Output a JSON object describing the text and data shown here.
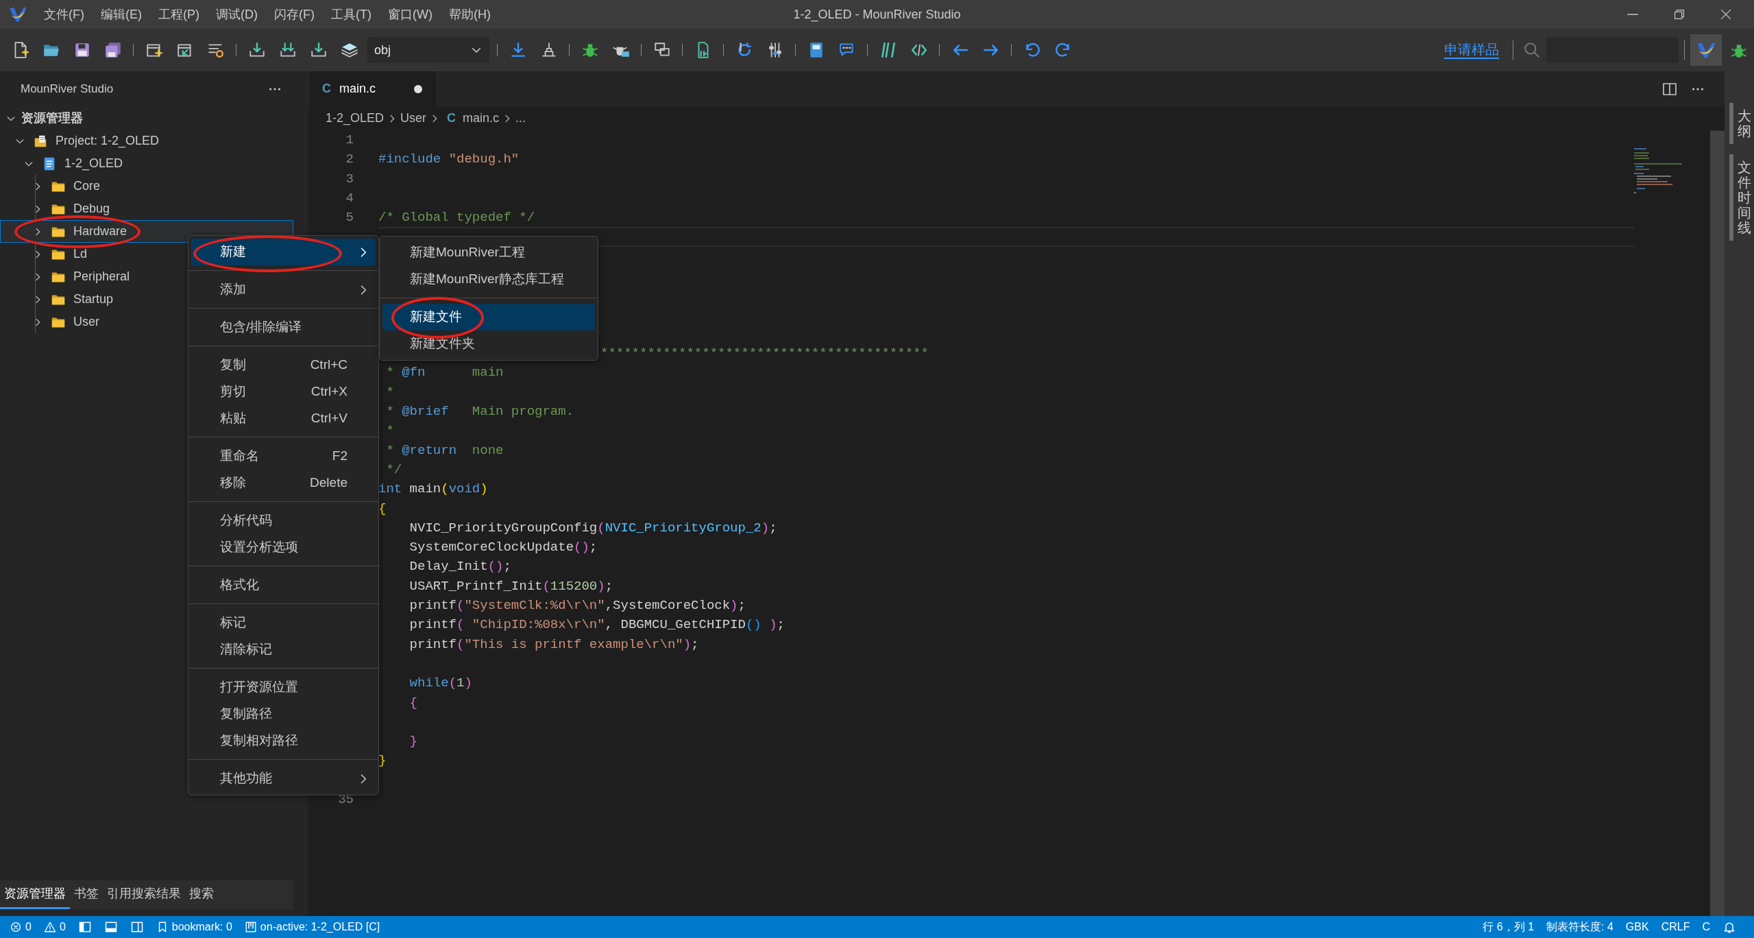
{
  "window": {
    "title": "1-2_OLED - MounRiver Studio"
  },
  "menu_bar": [
    "文件(F)",
    "编辑(E)",
    "工程(P)",
    "调试(D)",
    "闪存(F)",
    "工具(T)",
    "窗口(W)",
    "帮助(H)"
  ],
  "toolbar": {
    "config": "obj",
    "sample_link": "申请样品"
  },
  "explorer": {
    "title": "MounRiver Studio",
    "tree": [
      {
        "kind": "section",
        "label": "资源管理器",
        "expanded": true,
        "selected": false,
        "circled": false,
        "children": [
          {
            "kind": "project",
            "label": "Project: 1-2_OLED",
            "expanded": true,
            "selected": false,
            "circled": false,
            "children": [
              {
                "kind": "target",
                "label": "1-2_OLED",
                "expanded": true,
                "selected": false,
                "circled": false,
                "children": [
                  {
                    "kind": "folder",
                    "label": "Core",
                    "expanded": false,
                    "selected": false,
                    "circled": false
                  },
                  {
                    "kind": "folder",
                    "label": "Debug",
                    "expanded": false,
                    "selected": false,
                    "circled": false
                  },
                  {
                    "kind": "folder",
                    "label": "Hardware",
                    "expanded": false,
                    "selected": true,
                    "circled": true
                  },
                  {
                    "kind": "folder",
                    "label": "Ld",
                    "expanded": false,
                    "selected": false,
                    "circled": false
                  },
                  {
                    "kind": "folder",
                    "label": "Peripheral",
                    "expanded": false,
                    "selected": false,
                    "circled": false
                  },
                  {
                    "kind": "folder",
                    "label": "Startup",
                    "expanded": false,
                    "selected": false,
                    "circled": false
                  },
                  {
                    "kind": "folder",
                    "label": "User",
                    "expanded": false,
                    "selected": false,
                    "circled": false
                  }
                ]
              }
            ]
          }
        ]
      }
    ]
  },
  "bottom_tabs": [
    {
      "label": "资源管理器",
      "selected": true
    },
    {
      "label": "书签",
      "selected": false
    },
    {
      "label": "引用搜索结果",
      "selected": false
    },
    {
      "label": "搜索",
      "selected": false
    }
  ],
  "editor": {
    "tabs": [
      {
        "icon_text": "C",
        "label": "main.c",
        "selected": true,
        "modified": true
      }
    ],
    "breadcrumb": [
      {
        "label": "1-2_OLED"
      },
      {
        "label": "User"
      },
      {
        "icon_text": "C",
        "label": "main.c"
      },
      {
        "label": "..."
      }
    ],
    "lines": [
      {
        "number": "1",
        "current": false
      },
      {
        "number": "2",
        "current": false,
        "tokens": [
          {
            "text": "#include ",
            "kind": "keyword"
          },
          {
            "text": "\"debug.h\"",
            "kind": "string"
          }
        ]
      },
      {
        "number": "3",
        "current": false
      },
      {
        "number": "4",
        "current": false
      },
      {
        "number": "5",
        "current": false,
        "tokens": [
          {
            "text": "/* Global typedef */",
            "kind": "comment"
          }
        ]
      },
      {
        "current": true
      },
      {
        "current": false
      },
      {
        "current": false
      },
      {
        "current": false
      },
      {
        "current": false
      },
      {
        "current": false
      },
      {
        "current": false,
        "kind": "partial",
        "tokens": [
          {
            "text": "******************************************",
            "kind": "comment"
          }
        ]
      },
      {
        "current": false,
        "tokens": [
          {
            "text": " * ",
            "kind": "comment"
          },
          {
            "text": "@fn",
            "kind": "tag"
          },
          {
            "text": "      main",
            "kind": "comment"
          }
        ]
      },
      {
        "current": false,
        "tokens": [
          {
            "text": " *",
            "kind": "comment"
          }
        ]
      },
      {
        "current": false,
        "tokens": [
          {
            "text": " * ",
            "kind": "comment"
          },
          {
            "text": "@brief",
            "kind": "tag"
          },
          {
            "text": "   Main program.",
            "kind": "comment"
          }
        ]
      },
      {
        "current": false,
        "tokens": [
          {
            "text": " *",
            "kind": "comment"
          }
        ]
      },
      {
        "current": false,
        "tokens": [
          {
            "text": " * ",
            "kind": "comment"
          },
          {
            "text": "@return",
            "kind": "tag"
          },
          {
            "text": "  none",
            "kind": "comment"
          }
        ]
      },
      {
        "current": false,
        "tokens": [
          {
            "text": " */",
            "kind": "comment"
          }
        ]
      },
      {
        "current": false,
        "tokens": [
          {
            "text": "int",
            "kind": "keyword"
          },
          {
            "text": " main",
            "kind": "plain"
          },
          {
            "text": "(",
            "kind": "bracket1"
          },
          {
            "text": "void",
            "kind": "keyword"
          },
          {
            "text": ")",
            "kind": "bracket1"
          }
        ]
      },
      {
        "current": false,
        "tokens": [
          {
            "text": "{",
            "kind": "bracket1"
          }
        ]
      },
      {
        "current": false,
        "tokens": [
          {
            "text": "    NVIC_PriorityGroupConfig",
            "kind": "plain"
          },
          {
            "text": "(",
            "kind": "bracket2"
          },
          {
            "text": "NVIC_PriorityGroup_2",
            "kind": "macro"
          },
          {
            "text": ")",
            "kind": "bracket2"
          },
          {
            "text": ";",
            "kind": "plain"
          }
        ]
      },
      {
        "current": false,
        "tokens": [
          {
            "text": "    SystemCoreClockUpdate",
            "kind": "plain"
          },
          {
            "text": "()",
            "kind": "bracket2"
          },
          {
            "text": ";",
            "kind": "plain"
          }
        ]
      },
      {
        "current": false,
        "tokens": [
          {
            "text": "    Delay_Init",
            "kind": "plain"
          },
          {
            "text": "()",
            "kind": "bracket2"
          },
          {
            "text": ";",
            "kind": "plain"
          }
        ]
      },
      {
        "current": false,
        "tokens": [
          {
            "text": "    USART_Printf_Init",
            "kind": "plain"
          },
          {
            "text": "(",
            "kind": "bracket2"
          },
          {
            "text": "115200",
            "kind": "number"
          },
          {
            "text": ")",
            "kind": "bracket2"
          },
          {
            "text": ";",
            "kind": "plain"
          }
        ]
      },
      {
        "current": false,
        "tokens": [
          {
            "text": "    printf",
            "kind": "plain"
          },
          {
            "text": "(",
            "kind": "bracket2"
          },
          {
            "text": "\"SystemClk:%d\\r\\n\"",
            "kind": "string"
          },
          {
            "text": ",SystemCoreClock",
            "kind": "plain"
          },
          {
            "text": ")",
            "kind": "bracket2"
          },
          {
            "text": ";",
            "kind": "plain"
          }
        ]
      },
      {
        "current": false,
        "tokens": [
          {
            "text": "    printf",
            "kind": "plain"
          },
          {
            "text": "( ",
            "kind": "bracket2"
          },
          {
            "text": "\"ChipID:%08x\\r\\n\"",
            "kind": "string"
          },
          {
            "text": ", DBGMCU_GetCHIPID",
            "kind": "plain"
          },
          {
            "text": "() ",
            "kind": "bracket3"
          },
          {
            "text": ")",
            "kind": "bracket2"
          },
          {
            "text": ";",
            "kind": "plain"
          }
        ]
      },
      {
        "current": false,
        "tokens": [
          {
            "text": "    printf",
            "kind": "plain"
          },
          {
            "text": "(",
            "kind": "bracket2"
          },
          {
            "text": "\"This is printf example\\r\\n\"",
            "kind": "string"
          },
          {
            "text": ")",
            "kind": "bracket2"
          },
          {
            "text": ";",
            "kind": "plain"
          }
        ]
      },
      {
        "current": false
      },
      {
        "current": false,
        "tokens": [
          {
            "text": "    while",
            "kind": "keyword"
          },
          {
            "text": "(",
            "kind": "bracket2"
          },
          {
            "text": "1",
            "kind": "number"
          },
          {
            "text": ")",
            "kind": "bracket2"
          }
        ]
      },
      {
        "current": false,
        "tokens": [
          {
            "text": "    {",
            "kind": "bracket2"
          }
        ]
      },
      {
        "current": false
      },
      {
        "current": false,
        "tokens": [
          {
            "text": "    }",
            "kind": "bracket2"
          }
        ]
      },
      {
        "current": false,
        "tokens": [
          {
            "text": "}",
            "kind": "bracket1"
          }
        ]
      },
      {
        "current": false
      },
      {
        "number": "35",
        "current": false
      }
    ]
  },
  "right_panel_tabs": [
    {
      "label": "大纲"
    },
    {
      "label": "文件时间线"
    }
  ],
  "context_menu": {
    "groups": [
      [
        {
          "label": "新建",
          "has_submenu": true,
          "selected": true,
          "circled": true
        }
      ],
      [
        {
          "label": "添加",
          "has_submenu": true,
          "selected": false,
          "circled": false
        }
      ],
      [
        {
          "label": "包含/排除编译",
          "has_submenu": false,
          "selected": false,
          "circled": false
        }
      ],
      [
        {
          "label": "复制",
          "shortcut": "Ctrl+C",
          "has_submenu": false,
          "selected": false,
          "circled": false
        },
        {
          "label": "剪切",
          "shortcut": "Ctrl+X",
          "has_submenu": false,
          "selected": false,
          "circled": false
        },
        {
          "label": "粘贴",
          "shortcut": "Ctrl+V",
          "has_submenu": false,
          "selected": false,
          "circled": false
        }
      ],
      [
        {
          "label": "重命名",
          "shortcut": "F2",
          "has_submenu": false,
          "selected": false,
          "circled": false
        },
        {
          "label": "移除",
          "shortcut": "Delete",
          "has_submenu": false,
          "selected": false,
          "circled": false
        }
      ],
      [
        {
          "label": "分析代码",
          "has_submenu": false,
          "selected": false,
          "circled": false
        },
        {
          "label": "设置分析选项",
          "has_submenu": false,
          "selected": false,
          "circled": false
        }
      ],
      [
        {
          "label": "格式化",
          "has_submenu": false,
          "selected": false,
          "circled": false
        }
      ],
      [
        {
          "label": "标记",
          "has_submenu": false,
          "selected": false,
          "circled": false
        },
        {
          "label": "清除标记",
          "has_submenu": false,
          "selected": false,
          "circled": false
        }
      ],
      [
        {
          "label": "打开资源位置",
          "has_submenu": false,
          "selected": false,
          "circled": false
        },
        {
          "label": "复制路径",
          "has_submenu": false,
          "selected": false,
          "circled": false
        },
        {
          "label": "复制相对路径",
          "has_submenu": false,
          "selected": false,
          "circled": false
        }
      ],
      [
        {
          "label": "其他功能",
          "has_submenu": true,
          "selected": false,
          "circled": false
        }
      ]
    ]
  },
  "submenu": {
    "groups": [
      [
        {
          "label": "新建MounRiver工程",
          "selected": false,
          "circled": false
        },
        {
          "label": "新建MounRiver静态库工程",
          "selected": false,
          "circled": false
        }
      ],
      [
        {
          "label": "新建文件",
          "selected": true,
          "circled": true
        },
        {
          "label": "新建文件夹",
          "selected": false,
          "circled": false
        }
      ]
    ]
  },
  "status_bar": {
    "left": [
      {
        "kind": "errors",
        "text": "0"
      },
      {
        "kind": "warnings",
        "text": "0"
      },
      {
        "kind": "sidebar-toggle"
      },
      {
        "kind": "panel-toggle"
      },
      {
        "kind": "split-toggle"
      },
      {
        "kind": "bookmark",
        "text": "bookmark: 0"
      },
      {
        "kind": "active-project",
        "text": "on-active: 1-2_OLED [C]"
      }
    ],
    "right": [
      {
        "kind": "text",
        "text": "行 6，列 1"
      },
      {
        "kind": "text",
        "text": "制表符长度: 4"
      },
      {
        "kind": "text",
        "text": "GBK"
      },
      {
        "kind": "text",
        "text": "CRLF"
      },
      {
        "kind": "text",
        "text": "C"
      },
      {
        "kind": "bell"
      }
    ]
  }
}
